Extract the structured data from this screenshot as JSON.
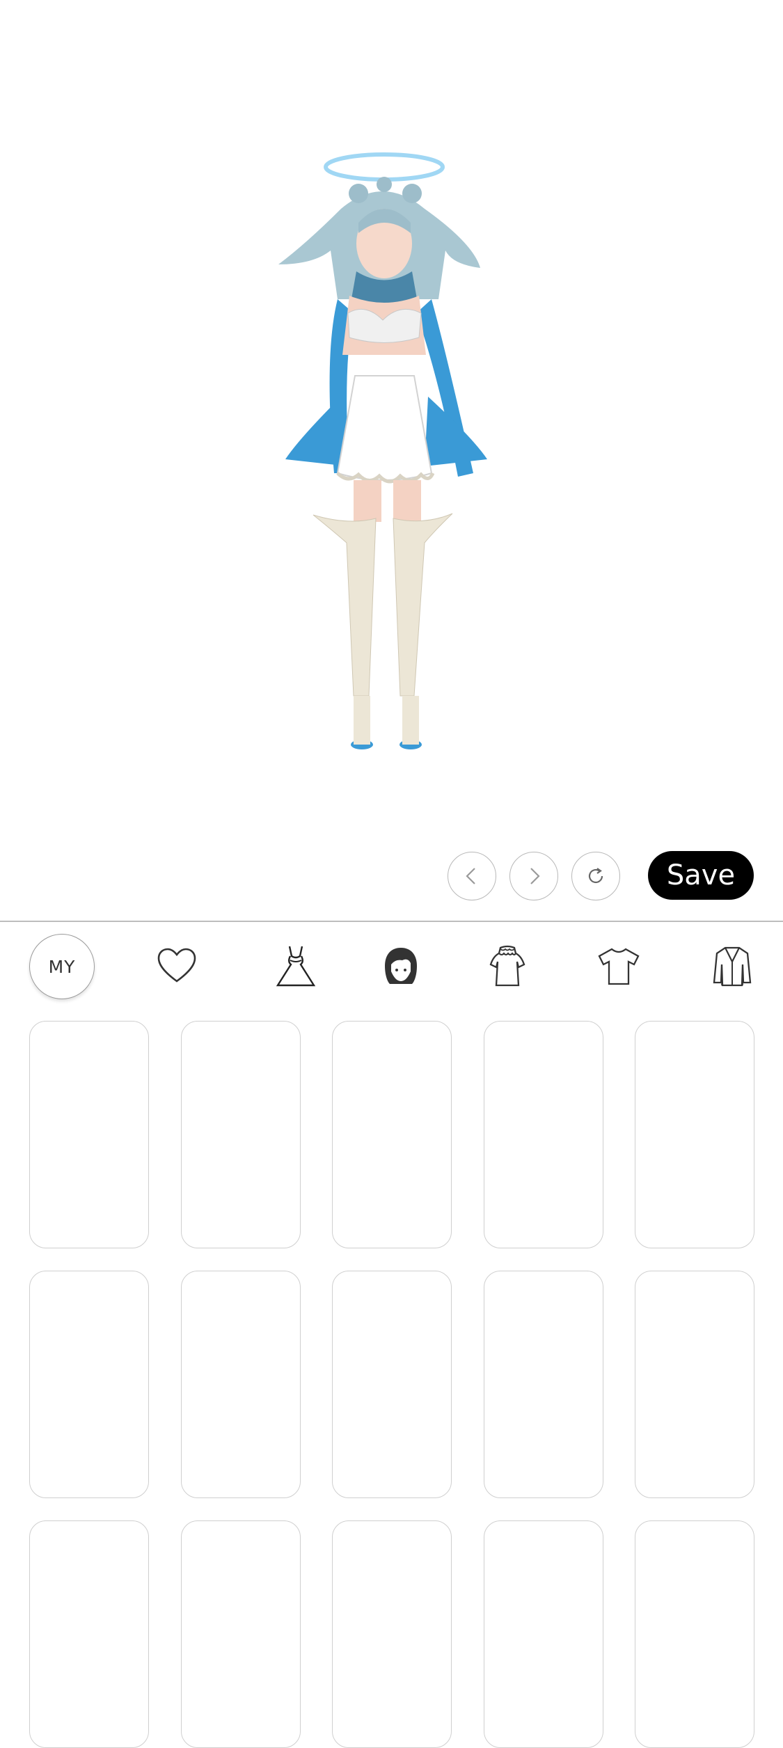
{
  "app": {
    "stage": {
      "avatar_description_icon": "character-avatar"
    }
  },
  "toolbar": {
    "undo_icon": "chevron-left-icon",
    "redo_icon": "chevron-right-icon",
    "reset_icon": "refresh-icon",
    "save_label": "Save"
  },
  "categories": {
    "my_label": "MY",
    "items": [
      {
        "icon": "heart-icon"
      },
      {
        "icon": "dress-icon"
      },
      {
        "icon": "hair-icon"
      },
      {
        "icon": "top-blouse-icon"
      },
      {
        "icon": "tshirt-icon"
      },
      {
        "icon": "jacket-icon"
      }
    ]
  },
  "grid": {
    "slot_count": 15
  },
  "colors": {
    "accent": "#000000",
    "border": "#cfcfcf",
    "hair": "#9fc3cf",
    "outfit_blue": "#3a9ad6",
    "halo": "#8fd0f2"
  }
}
